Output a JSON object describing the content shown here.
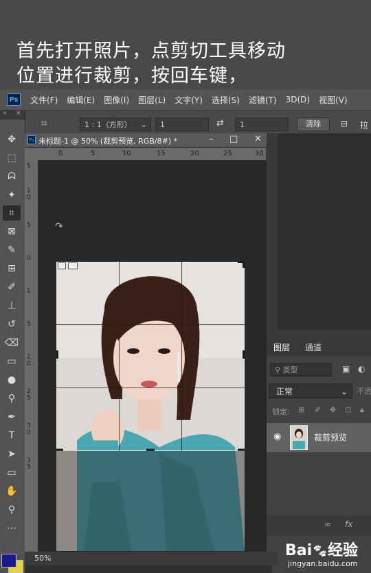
{
  "caption": {
    "line1": "首先打开照片，点剪切工具移动",
    "line2": "位置进行裁剪，按回车键，"
  },
  "app": {
    "logo": "Ps"
  },
  "menu": [
    "文件(F)",
    "编辑(E)",
    "图像(I)",
    "图层(L)",
    "文字(Y)",
    "选择(S)",
    "滤镜(T)",
    "3D(D)",
    "视图(V)"
  ],
  "options": {
    "ratio": "1 : 1（方形）",
    "width": "1",
    "height": "1",
    "clear": "清除",
    "straighten": "拉"
  },
  "document": {
    "tab_title": "未标题-1 @ 50% (裁剪预览, RGB/8#) *",
    "zoom": "50%",
    "ruler_h": [
      "0",
      "5",
      "10",
      "15",
      "20",
      "25",
      "30"
    ],
    "ruler_v": [
      "5",
      "1",
      "0",
      "5",
      "0",
      "1",
      "5",
      "2",
      "0",
      "2",
      "5",
      "3",
      "0",
      "3",
      "5"
    ]
  },
  "layers": {
    "tabs": [
      "图层",
      "通道"
    ],
    "filter_placeholder": "类型",
    "blend_mode": "正常",
    "opacity_label": "不透",
    "lock_label": "锁定:",
    "layer_name": "裁剪预览",
    "footer_link": "∞",
    "footer_fx": "fx"
  },
  "watermark": {
    "brand": "Bai",
    "brand2": "经验",
    "url": "jingyan.baidu.com"
  },
  "colors": {
    "foreground": "#1a1a8a",
    "background": "#e8d23c",
    "accent": "#3b9cff"
  }
}
